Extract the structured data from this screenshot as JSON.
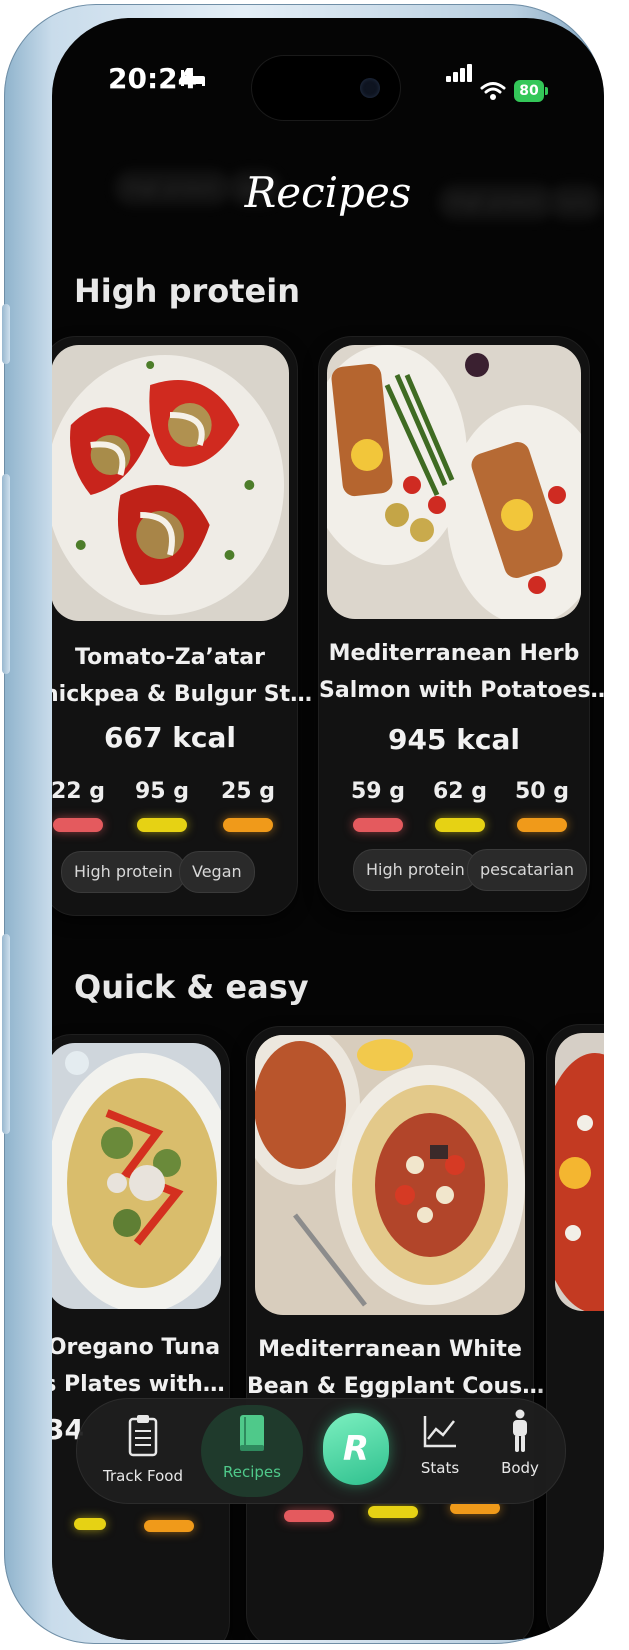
{
  "status_bar": {
    "time": "20:24",
    "battery": "80"
  },
  "header": {
    "title": "Recipes",
    "ghost_chips": [
      "High protein",
      "glut",
      "High protein",
      "lunc"
    ]
  },
  "sections": [
    {
      "title": "High protein",
      "cards": [
        {
          "name_line1": "Tomato-Za’atar",
          "name_line2": "hickpea & Bulgur St…",
          "kcal": "667 kcal",
          "macros": [
            "22 g",
            "95 g",
            "25 g"
          ],
          "tags": [
            "High protein",
            "Vegan"
          ]
        },
        {
          "name_line1": "Mediterranean Herb",
          "name_line2": "Salmon with Potatoes…",
          "kcal": "945 kcal",
          "macros": [
            "59 g",
            "62 g",
            "50 g"
          ],
          "tags": [
            "High protein",
            "pescatarian"
          ]
        }
      ]
    },
    {
      "title": "Quick & easy",
      "cards": [
        {
          "name_line1": "Oregano Tuna",
          "name_line2": "s Plates with…",
          "kcal": "34"
        },
        {
          "name_line1": "Mediterranean White",
          "name_line2": "Bean & Eggplant Cous…"
        }
      ]
    }
  ],
  "tab_bar": {
    "items": [
      {
        "label": "Track Food",
        "icon": "clipboard-icon"
      },
      {
        "label": "Recipes",
        "icon": "book-icon",
        "active": true
      },
      {
        "label": "",
        "icon": "app-logo-icon"
      },
      {
        "label": "Stats",
        "icon": "chart-icon"
      },
      {
        "label": "Body",
        "icon": "person-icon"
      }
    ]
  },
  "colors": {
    "protein": "#e45a5e",
    "carbs": "#e6d214",
    "fat": "#f09a1a",
    "accent": "#4fc98a",
    "battery": "#34c759"
  }
}
